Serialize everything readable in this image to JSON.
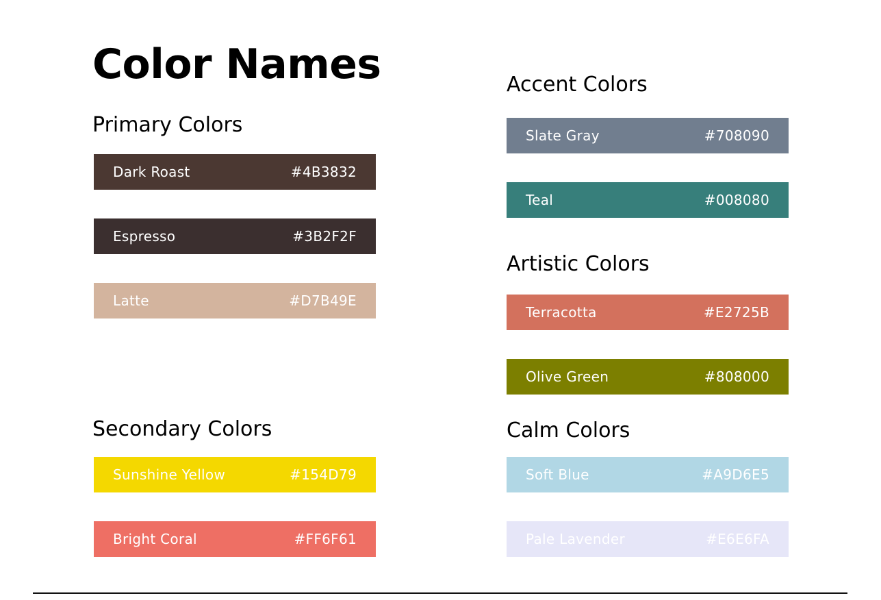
{
  "title": "Color Names",
  "sections": {
    "primary": {
      "heading": "Primary Colors",
      "swatches": [
        {
          "name": "Dark Roast",
          "hex": "#4B3832",
          "color": "#4B3832"
        },
        {
          "name": "Espresso",
          "hex": "#3B2F2F",
          "color": "#3B2F2F"
        },
        {
          "name": "Latte",
          "hex": "#D7B49E",
          "color": "#D3B49E"
        }
      ]
    },
    "secondary": {
      "heading": "Secondary Colors",
      "swatches": [
        {
          "name": "Sunshine Yellow",
          "hex": "#154D79",
          "color": "#F4D800"
        },
        {
          "name": "Bright Coral",
          "hex": "#FF6F61",
          "color": "#EE6F64"
        }
      ]
    },
    "accent": {
      "heading": "Accent Colors",
      "swatches": [
        {
          "name": "Slate Gray",
          "hex": "#708090",
          "color": "#717E8F"
        },
        {
          "name": "Teal",
          "hex": "#008080",
          "color": "#377F7B"
        }
      ]
    },
    "artistic": {
      "heading": "Artistic Colors",
      "swatches": [
        {
          "name": "Terracotta",
          "hex": "#E2725B",
          "color": "#D3715D"
        },
        {
          "name": "Olive Green",
          "hex": "#808000",
          "color": "#7C7F00"
        }
      ]
    },
    "calm": {
      "heading": "Calm Colors",
      "swatches": [
        {
          "name": "Soft Blue",
          "hex": "#A9D6E5",
          "color": "#B1D7E5"
        },
        {
          "name": "Pale Lavender",
          "hex": "#E6E6FA",
          "color": "#E6E6F8"
        }
      ]
    }
  }
}
